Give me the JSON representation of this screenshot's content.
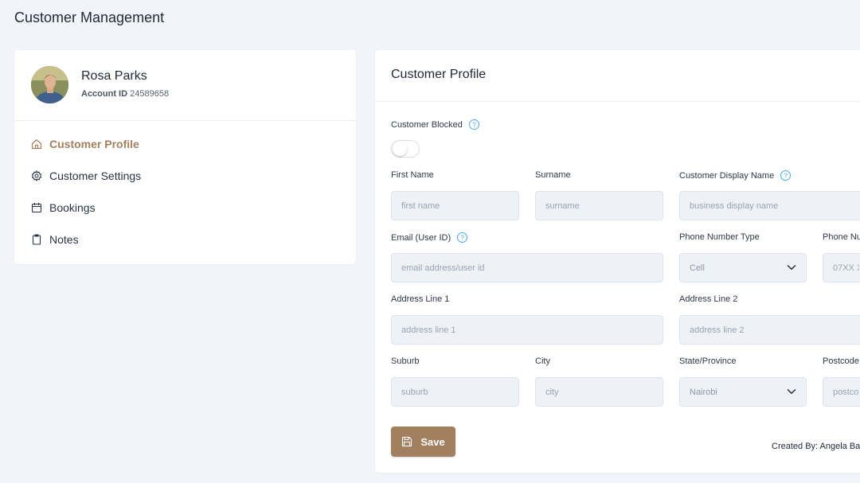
{
  "page": {
    "title": "Customer Management"
  },
  "customer": {
    "name": "Rosa Parks",
    "account_label": "Account ID",
    "account_id": "24589658"
  },
  "nav": {
    "items": [
      {
        "label": "Customer Profile",
        "icon": "home-icon",
        "active": true
      },
      {
        "label": "Customer Settings",
        "icon": "gear-icon",
        "active": false
      },
      {
        "label": "Bookings",
        "icon": "calendar-icon",
        "active": false
      },
      {
        "label": "Notes",
        "icon": "clipboard-icon",
        "active": false
      }
    ]
  },
  "profile": {
    "title": "Customer Profile",
    "blocked_label": "Customer Blocked",
    "blocked": false,
    "fields": {
      "first_name": {
        "label": "First Name",
        "placeholder": "first name"
      },
      "surname": {
        "label": "Surname",
        "placeholder": "surname"
      },
      "display_name": {
        "label": "Customer Display Name",
        "placeholder": "business display name"
      },
      "email": {
        "label": "Email (User ID)",
        "placeholder": "email address/user id"
      },
      "phone_type": {
        "label": "Phone Number Type",
        "value": "Cell"
      },
      "phone_number": {
        "label": "Phone Nu",
        "placeholder": "07XX X"
      },
      "address1": {
        "label": "Address Line 1",
        "placeholder": "address line 1"
      },
      "address2": {
        "label": "Address Line 2",
        "placeholder": "address line 2"
      },
      "suburb": {
        "label": "Suburb",
        "placeholder": "suburb"
      },
      "city": {
        "label": "City",
        "placeholder": "city"
      },
      "state": {
        "label": "State/Province",
        "value": "Nairobi"
      },
      "postcode": {
        "label": "Postcode",
        "placeholder": "postco"
      }
    },
    "save_label": "Save",
    "created_by": "Created By: Angela Ba"
  },
  "colors": {
    "accent": "#a27f5e",
    "help": "#4aa8e8",
    "page_bg": "#f1f4f8"
  }
}
